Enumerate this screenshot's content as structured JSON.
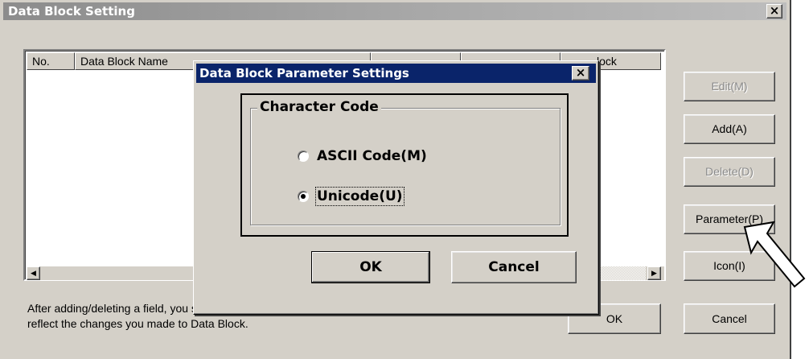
{
  "window": {
    "title": "Data Block Setting",
    "close_glyph": "×"
  },
  "list": {
    "columns": [
      "No.",
      "Data Block Name",
      "",
      "",
      "lock"
    ],
    "scroll_left_glyph": "◀",
    "scroll_right_glyph": "▶"
  },
  "buttons": {
    "edit": "Edit(M)",
    "add": "Add(A)",
    "delete": "Delete(D)",
    "parameter": "Parameter(P)",
    "icon": "Icon(I)",
    "ok": "OK",
    "cancel": "Cancel"
  },
  "note": "After adding/deleting a field, you should click the [OK] button on the property dialog box of Data Block Table to reflect the changes you made to Data Block.",
  "dialog": {
    "title": "Data Block Parameter Settings",
    "close_glyph": "×",
    "group_label": "Character Code",
    "options": [
      {
        "label": "ASCII Code(M)",
        "selected": false
      },
      {
        "label": "Unicode(U)",
        "selected": true
      }
    ],
    "ok": "OK",
    "cancel": "Cancel"
  },
  "icons": {
    "pointer_arrow": "arrow-icon"
  },
  "colors": {
    "face": "#d4d0c8",
    "dialog_title": "#0a246a",
    "window_title_inactive": "#a0a0a0"
  }
}
